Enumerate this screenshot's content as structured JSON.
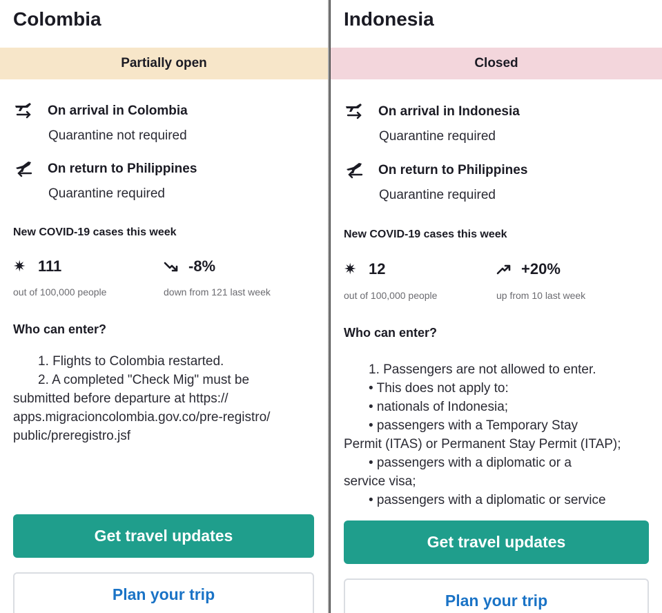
{
  "left": {
    "country": "Colombia",
    "status": "Partially open",
    "arrival_heading": "On arrival in Colombia",
    "arrival_quarantine": "Quarantine not required",
    "return_heading": "On return to Philippines",
    "return_quarantine": "Quarantine required",
    "cases_title": "New COVID-19 cases this week",
    "cases_value": "111",
    "cases_note": "out of 100,000 people",
    "trend_value": "-8%",
    "trend_note": "down from 121 last week",
    "trend_icon": "trend-down-icon",
    "who_title": "Who can enter?",
    "entry_lines": [
      "1.   Flights to Colombia restarted.",
      "2.   A completed \"Check Mig\" must be",
      "submitted before departure at https://",
      "apps.migracioncolombia.gov.co/pre-registro/",
      "public/preregistro.jsf"
    ],
    "primary_button": "Get travel updates",
    "secondary_button": "Plan your trip"
  },
  "right": {
    "country": "Indonesia",
    "status": "Closed",
    "arrival_heading": "On arrival in Indonesia",
    "arrival_quarantine": "Quarantine required",
    "return_heading": "On return to Philippines",
    "return_quarantine": "Quarantine required",
    "cases_title": "New COVID-19 cases this week",
    "cases_value": "12",
    "cases_note": "out of 100,000 people",
    "trend_value": "+20%",
    "trend_note": "up from 10 last week",
    "trend_icon": "trend-up-icon",
    "who_title": "Who can enter?",
    "entry_lines": [
      "1.   Passengers are not allowed to enter.",
      "•   This does not apply to:",
      "•   nationals of Indonesia;",
      "•   passengers with a Temporary Stay",
      "Permit (ITAS) or Permanent Stay Permit (ITAP);",
      "•   passengers with a diplomatic or a",
      "service visa;",
      "•   passengers with a diplomatic or service"
    ],
    "primary_button": "Get travel updates",
    "secondary_button": "Plan your trip"
  },
  "colors": {
    "status_partial": "#f7e6c9",
    "status_closed": "#f3d6dc",
    "primary_button": "#1f9e8c",
    "secondary_text": "#1a73c6"
  },
  "icons": [
    "plane-arrival-icon",
    "plane-departure-icon",
    "virus-icon",
    "trend-down-icon",
    "trend-up-icon"
  ]
}
